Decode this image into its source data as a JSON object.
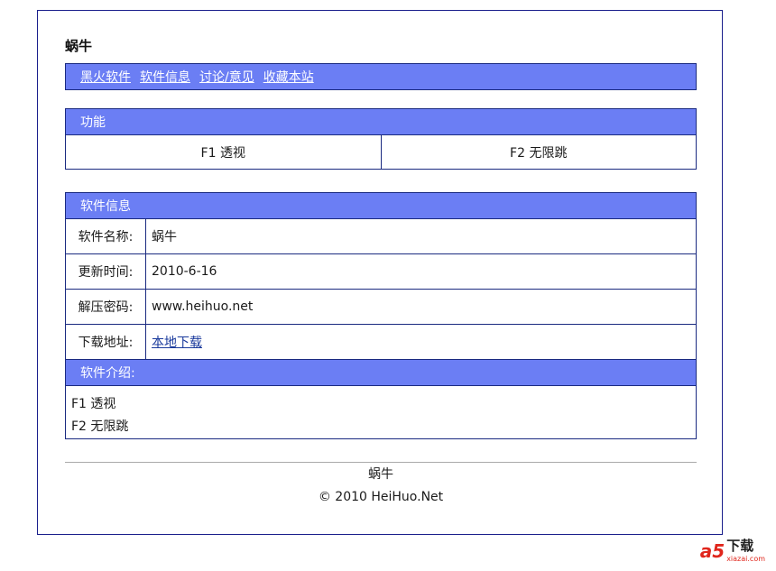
{
  "app_title": "蜗牛",
  "nav": {
    "items": [
      "黑火软件",
      "软件信息",
      "讨论/意见",
      "收藏本站"
    ]
  },
  "features": {
    "header": "功能",
    "items": [
      "F1 透视",
      "F2 无限跳"
    ]
  },
  "info": {
    "header": "软件信息",
    "rows": [
      {
        "label": "软件名称:",
        "value": "蜗牛"
      },
      {
        "label": "更新时间:",
        "value": "2010-6-16"
      },
      {
        "label": "解压密码:",
        "value": "www.heihuo.net"
      },
      {
        "label": "下载地址:",
        "value": "本地下载"
      }
    ],
    "intro_header": "软件介绍:",
    "intro_lines": [
      "F1 透视",
      "F2 无限跳"
    ]
  },
  "footer": {
    "name": "蜗牛",
    "copyright": "© 2010 HeiHuo.Net"
  },
  "watermark": {
    "logo": "a5",
    "main": "下载",
    "sub": "xiazai.com"
  },
  "colors": {
    "header_bg": "#6b7ef4",
    "border": "#1a2a80",
    "frame_border": "#1a1f8c"
  }
}
